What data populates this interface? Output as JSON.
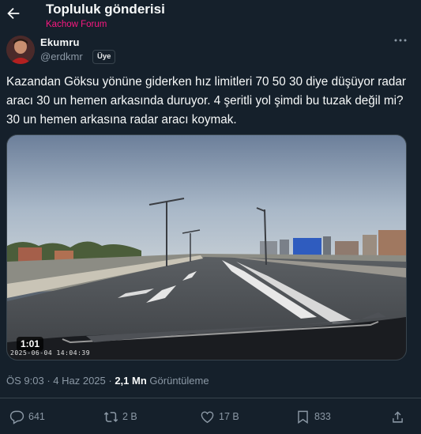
{
  "header": {
    "title": "Topluluk gönderisi",
    "community": "Kachow Forum"
  },
  "author": {
    "name": "Ekumru",
    "handle": "@erdkmr",
    "badge": "Üye"
  },
  "post": {
    "text": "Kazandan Göksu yönüne giderken hız limitleri 70 50 30 diye düşüyor radar aracı 30 un hemen arkasında duruyor. 4 şeritli yol şimdi bu tuzak değil mi? 30 un hemen arkasına radar aracı koymak.",
    "video": {
      "duration": "1:01",
      "timestamp_overlay": "2025-06-04 14:04:39"
    },
    "time": "ÖS 9:03",
    "date": "4 Haz 2025",
    "views_count": "2,1 Mn",
    "views_label": "Görüntüleme"
  },
  "actions": {
    "replies": "641",
    "reposts": "2 B",
    "likes": "17 B",
    "bookmarks": "833"
  },
  "colors": {
    "background": "#15202b",
    "accent_pink": "#f91880",
    "muted_text": "#8b98a5",
    "border": "#38444d"
  },
  "icons": [
    "back-arrow-icon",
    "more-icon",
    "reply-icon",
    "repost-icon",
    "like-icon",
    "bookmark-icon",
    "share-icon"
  ]
}
